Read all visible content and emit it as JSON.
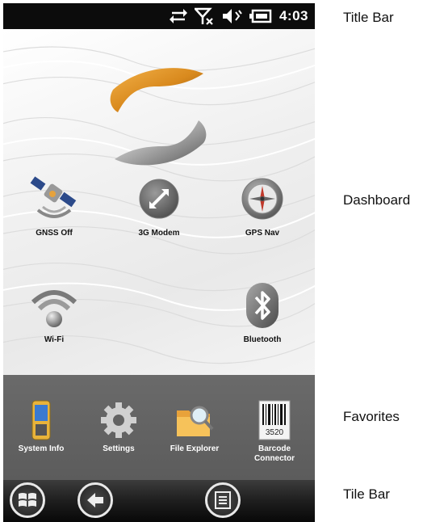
{
  "status_bar": {
    "time": "4:03",
    "icons": [
      "sync-arrows-icon",
      "signal-off-icon",
      "volume-muted-icon",
      "battery-charging-icon"
    ]
  },
  "dashboard": {
    "apps": [
      {
        "label": "GNSS Off",
        "icon": "satellite-icon"
      },
      {
        "label": "3G Modem",
        "icon": "modem-arrows-icon"
      },
      {
        "label": "GPS Nav",
        "icon": "compass-icon"
      },
      {
        "label": "Wi-Fi",
        "icon": "wifi-icon"
      },
      {
        "label": "Bluetooth",
        "icon": "bluetooth-icon"
      }
    ]
  },
  "favorites": {
    "apps": [
      {
        "label": "System Info",
        "icon": "handheld-device-icon"
      },
      {
        "label": "Settings",
        "icon": "gear-icon"
      },
      {
        "label": "File Explorer",
        "icon": "folder-search-icon"
      },
      {
        "label": "Barcode Connector",
        "icon": "barcode-icon",
        "barcode_number": "3520"
      }
    ]
  },
  "tile_bar": {
    "buttons": [
      "windows-start-icon",
      "back-arrow-icon",
      "menu-list-icon"
    ]
  },
  "callouts": {
    "title_bar": "Title Bar",
    "dashboard": "Dashboard",
    "favorites": "Favorites",
    "tile_bar": "Tile Bar"
  },
  "colors": {
    "status_bar_bg": "#0c0c0c",
    "favorites_bg": "#626262",
    "logo_orange": "#d98a1e",
    "logo_silver": "#9a9a9a"
  }
}
